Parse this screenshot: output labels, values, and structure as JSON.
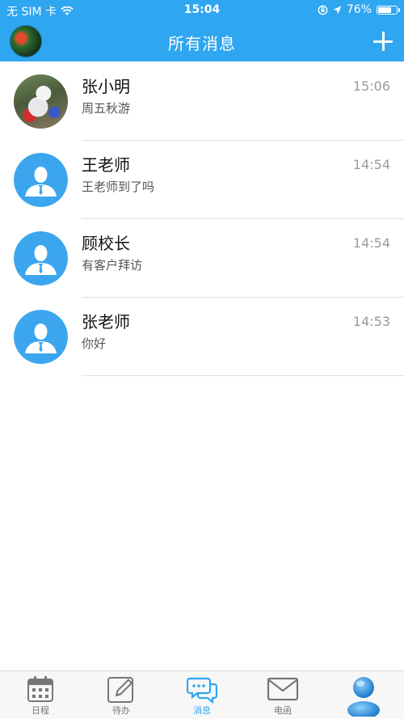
{
  "status_bar": {
    "carrier": "无 SIM 卡",
    "time": "15:04",
    "battery_text": "76%",
    "battery_level": 0.76
  },
  "nav": {
    "title": "所有消息"
  },
  "messages": [
    {
      "name": "张小明",
      "preview": "周五秋游",
      "time": "15:06",
      "avatar": "photo"
    },
    {
      "name": "王老师",
      "preview": "王老师到了吗",
      "time": "14:54",
      "avatar": "default-person-icon"
    },
    {
      "name": "顾校长",
      "preview": "有客户拜访",
      "time": "14:54",
      "avatar": "default-person-icon"
    },
    {
      "name": "张老师",
      "preview": "你好",
      "time": "14:53",
      "avatar": "default-person-icon"
    }
  ],
  "tabs": [
    {
      "label": "日程",
      "icon": "calendar-icon",
      "active": false
    },
    {
      "label": "待办",
      "icon": "edit-icon",
      "active": false
    },
    {
      "label": "消息",
      "icon": "chat-bubbles-icon",
      "active": true
    },
    {
      "label": "电函",
      "icon": "mail-icon",
      "active": false
    },
    {
      "label": "",
      "icon": "profile-person-icon",
      "active": false
    }
  ],
  "colors": {
    "accent": "#2fa6f0",
    "avatar_blue": "#3ba6ee"
  }
}
